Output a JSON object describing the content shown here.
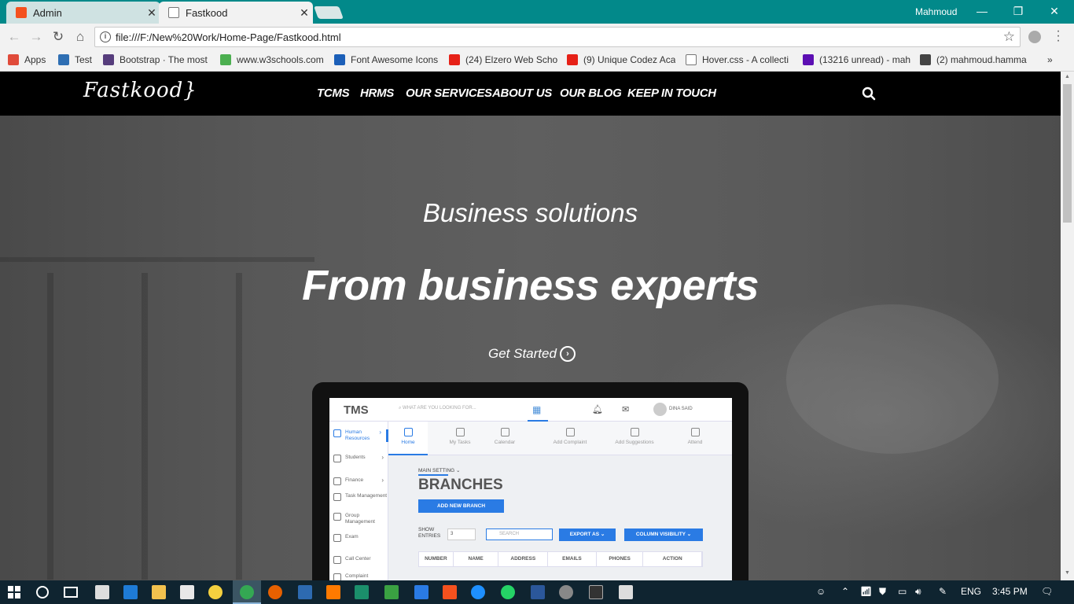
{
  "browser": {
    "tabs": [
      {
        "title": "Admin",
        "favicon_color": "#f4511e"
      },
      {
        "title": "Fastkood",
        "favicon_color": "#ffffff"
      }
    ],
    "profile_name": "Mahmoud",
    "url": "file:///F:/New%20Work/Home-Page/Fastkood.html",
    "window_controls": [
      "—",
      "❐",
      "✕"
    ]
  },
  "bookmarks": [
    {
      "label": "Apps",
      "icon": "apps-grid-icon",
      "color": "#e04b3a"
    },
    {
      "label": "Test",
      "icon": "globe-icon",
      "color": "#2f6fb3"
    },
    {
      "label": "Bootstrap · The most",
      "icon": "bootstrap-icon",
      "color": "#563d7c"
    },
    {
      "label": "www.w3schools.com",
      "icon": "w3schools-icon",
      "color": "#4caf50"
    },
    {
      "label": "Font Awesome Icons",
      "icon": "flag-icon",
      "color": "#1c5fb8"
    },
    {
      "label": "(24) Elzero Web Scho",
      "icon": "youtube-icon",
      "color": "#e62117"
    },
    {
      "label": "(9) Unique Codez Aca",
      "icon": "youtube-icon",
      "color": "#e62117"
    },
    {
      "label": "Hover.css - A collecti",
      "icon": "page-icon",
      "color": "#ffffff"
    },
    {
      "label": "(13216 unread) - mah",
      "icon": "yahoo-icon",
      "color": "#5c0fb3"
    },
    {
      "label": "(2) mahmoud.hamma",
      "icon": "xing-icon",
      "color": "#444444"
    },
    {
      "label": "»",
      "icon": "more-icon",
      "color": "#333333"
    }
  ],
  "site": {
    "logo": "Fastkood}",
    "nav": [
      "TCMS",
      "HRMS",
      "OUR SERVICES",
      "ABOUT US",
      "OUR BLOG",
      "KEEP IN TOUCH"
    ],
    "hero_subtitle": "Business solutions",
    "hero_title": "From business experts",
    "cta_label": "Get Started",
    "cta_icon": "chevron-circle-right-icon"
  },
  "app_preview": {
    "logo": "TMS",
    "search_placeholder": "WHAT ARE YOU LOOKING FOR...",
    "user": "DINA SAID",
    "sidebar": [
      {
        "label": "Human Resources",
        "active": true
      },
      {
        "label": "Students",
        "active": false
      },
      {
        "label": "Finance",
        "active": false
      },
      {
        "label": "Task Management",
        "active": false
      },
      {
        "label": "Group Management",
        "active": false
      },
      {
        "label": "Exam",
        "active": false
      },
      {
        "label": "Call Center",
        "active": false
      },
      {
        "label": "Complaint",
        "active": false
      }
    ],
    "tabs": [
      "Home",
      "My Tasks",
      "Calendar",
      "Add Complaint",
      "Add Suggestions",
      "Attend"
    ],
    "breadcrumb": "MAIN SETTING ⌄",
    "page_title": "BRANCHES",
    "add_button": "ADD NEW BRANCH",
    "show_entries": "SHOW ENTRIES",
    "entries_value": "3",
    "table_search": "SEARCH",
    "export_button": "EXPORT AS ⌄",
    "colvis_button": "COLUMN VISIBILITY ⌄",
    "columns": [
      "NUMBER",
      "NAME",
      "ADDRESS",
      "EMAILS",
      "PHONES",
      "ACTION"
    ]
  },
  "taskbar": {
    "lang": "ENG",
    "time": "3:45 PM"
  }
}
